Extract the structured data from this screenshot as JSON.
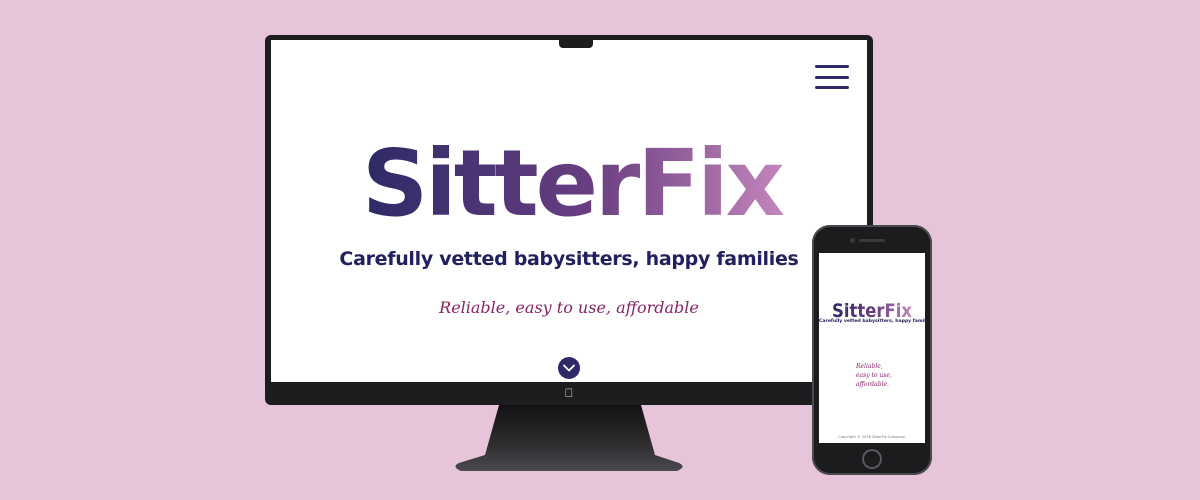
{
  "brand": {
    "name_part1": "Sitter",
    "name_part2": "Fix",
    "tagline": "Carefully vetted babysitters, happy families",
    "subtagline": "Reliable, easy to use, affordable"
  },
  "desktop": {
    "menu_icon": "hamburger-menu-icon",
    "scroll_icon": "chevron-down-icon",
    "device_logo_icon": "apple-logo-icon"
  },
  "mobile": {
    "subtagline_lines": [
      "Reliable,",
      "easy to use,",
      "affordable."
    ],
    "footer": "Copyright © 2018 SitterFix Company."
  },
  "colors": {
    "background": "#e6c4da",
    "brand_dark": "#2d2a66",
    "brand_mid": "#6a3f82",
    "brand_light": "#c486bb",
    "accent": "#8a2368"
  }
}
